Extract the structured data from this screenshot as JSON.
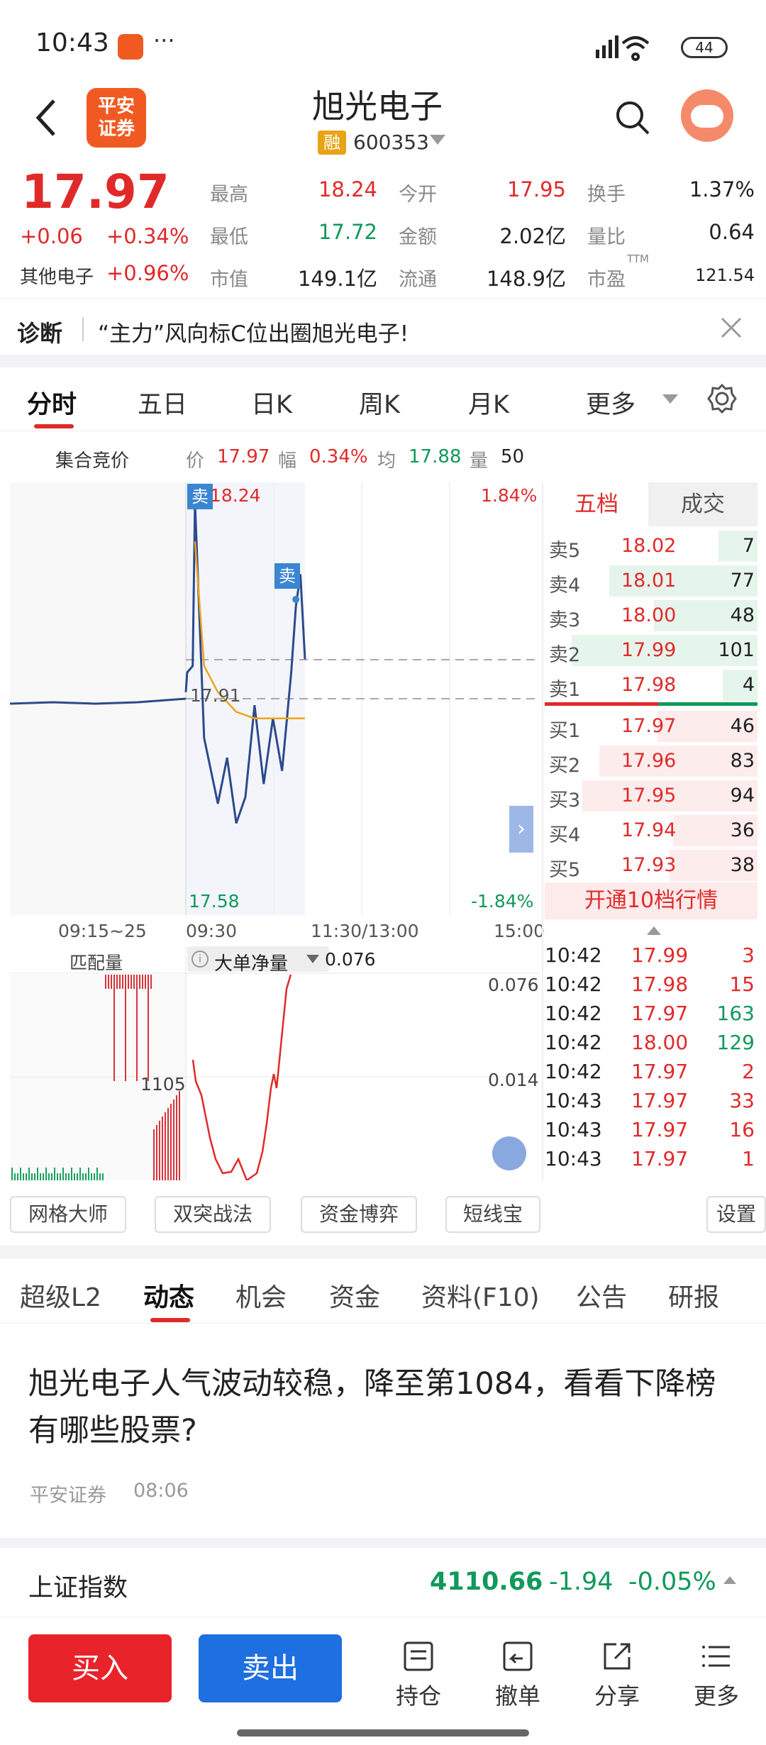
{
  "status": {
    "time": "10:43",
    "battery": "44"
  },
  "header": {
    "logo_line1": "平安",
    "logo_line2": "证券",
    "title": "旭光电子",
    "margin_badge": "融",
    "code": "600353"
  },
  "quote": {
    "price": "17.97",
    "change": "+0.06",
    "change_pct": "+0.34%",
    "sector_name": "其他电子",
    "sector_pct": "+0.96%",
    "high_label": "最高",
    "high": "18.24",
    "open_label": "今开",
    "open": "17.95",
    "turnover_label": "换手",
    "turnover": "1.37%",
    "low_label": "最低",
    "low": "17.72",
    "amount_label": "金额",
    "amount": "2.02亿",
    "volratio_label": "量比",
    "volratio": "0.64",
    "mcap_label": "市值",
    "mcap": "149.1亿",
    "float_label": "流通",
    "float": "148.9亿",
    "pe_label": "市盈",
    "pe_sup": "TTM",
    "pe": "121.54"
  },
  "diagnosis": {
    "label": "诊断",
    "text": "“主力”风向标C位出圈旭光电子!"
  },
  "chart_tabs": [
    "分时",
    "五日",
    "日K",
    "周K",
    "月K",
    "更多"
  ],
  "chart_info": {
    "auction": "集合竞价",
    "price_label": "价",
    "price": "17.97",
    "amp_label": "幅",
    "amp": "0.34%",
    "avg_label": "均",
    "avg": "17.88",
    "vol_label": "量",
    "vol": "50"
  },
  "chart_labels": {
    "top_left": "18.24",
    "top_right": "1.84%",
    "bottom_left": "17.58",
    "bottom_right": "-1.84%",
    "mid": "17.91",
    "sell_marker": "卖",
    "time_ticks": [
      "09:15~25",
      "09:30",
      "11:30/13:00",
      "15:00"
    ]
  },
  "sub_chart": {
    "left_label": "匹配量",
    "indicator": "大单净量",
    "value": "0.076",
    "right_top": "0.076",
    "right_mid": "0.014",
    "left_mid": "1105"
  },
  "chart_data": {
    "type": "line",
    "title": "",
    "ylim": [
      17.58,
      18.24
    ],
    "series": [
      {
        "name": "价",
        "points": [
          [
            0,
            17.92
          ],
          [
            0.3,
            17.95
          ],
          [
            1.5,
            17.96
          ],
          [
            2,
            18.21
          ],
          [
            4,
            17.85
          ],
          [
            7,
            17.75
          ],
          [
            9,
            17.82
          ],
          [
            11,
            17.72
          ],
          [
            13,
            17.76
          ],
          [
            15,
            17.9
          ],
          [
            17,
            17.78
          ],
          [
            19,
            17.88
          ],
          [
            21,
            17.8
          ],
          [
            23,
            17.95
          ],
          [
            24,
            18.05
          ],
          [
            25,
            18.1
          ],
          [
            26,
            17.97
          ]
        ]
      },
      {
        "name": "均",
        "points": [
          [
            2,
            18.15
          ],
          [
            4,
            17.96
          ],
          [
            7,
            17.92
          ],
          [
            11,
            17.89
          ],
          [
            15,
            17.88
          ],
          [
            19,
            17.88
          ],
          [
            23,
            17.88
          ],
          [
            26,
            17.88
          ]
        ]
      }
    ]
  },
  "order_book": {
    "tab_levels": "五档",
    "tab_trades": "成交",
    "asks": [
      {
        "label": "卖5",
        "price": "18.02",
        "vol": "7"
      },
      {
        "label": "卖4",
        "price": "18.01",
        "vol": "77"
      },
      {
        "label": "卖3",
        "price": "18.00",
        "vol": "48"
      },
      {
        "label": "卖2",
        "price": "17.99",
        "vol": "101"
      },
      {
        "label": "卖1",
        "price": "17.98",
        "vol": "4"
      }
    ],
    "bids": [
      {
        "label": "买1",
        "price": "17.97",
        "vol": "46"
      },
      {
        "label": "买2",
        "price": "17.96",
        "vol": "83"
      },
      {
        "label": "买3",
        "price": "17.95",
        "vol": "94"
      },
      {
        "label": "买4",
        "price": "17.94",
        "vol": "36"
      },
      {
        "label": "买5",
        "price": "17.93",
        "vol": "38"
      }
    ],
    "open10": "开通10档行情"
  },
  "tape": [
    {
      "time": "10:42",
      "price": "17.99",
      "vol": "3"
    },
    {
      "time": "10:42",
      "price": "17.98",
      "vol": "15"
    },
    {
      "time": "10:42",
      "price": "17.97",
      "vol": "163"
    },
    {
      "time": "10:42",
      "price": "18.00",
      "vol": "129"
    },
    {
      "time": "10:42",
      "price": "17.97",
      "vol": "2"
    },
    {
      "time": "10:43",
      "price": "17.97",
      "vol": "33"
    },
    {
      "time": "10:43",
      "price": "17.97",
      "vol": "16"
    },
    {
      "time": "10:43",
      "price": "17.97",
      "vol": "1"
    }
  ],
  "tools": [
    "网格大师",
    "双突战法",
    "资金博弈",
    "短线宝",
    "设置"
  ],
  "news_tabs": [
    "超级L2",
    "动态",
    "机会",
    "资金",
    "资料(F10)",
    "公告",
    "研报"
  ],
  "news": {
    "title": "旭光电子人气波动较稳，降至第1084，看看下降榜有哪些股票?",
    "source": "平安证券",
    "time": "08:06"
  },
  "index": {
    "name": "上证指数",
    "value": "4110.66",
    "change": "-1.94",
    "pct": "-0.05%"
  },
  "bottom": {
    "buy": "买入",
    "sell": "卖出",
    "hold": "持仓",
    "cancel": "撤单",
    "share": "分享",
    "more": "更多"
  }
}
